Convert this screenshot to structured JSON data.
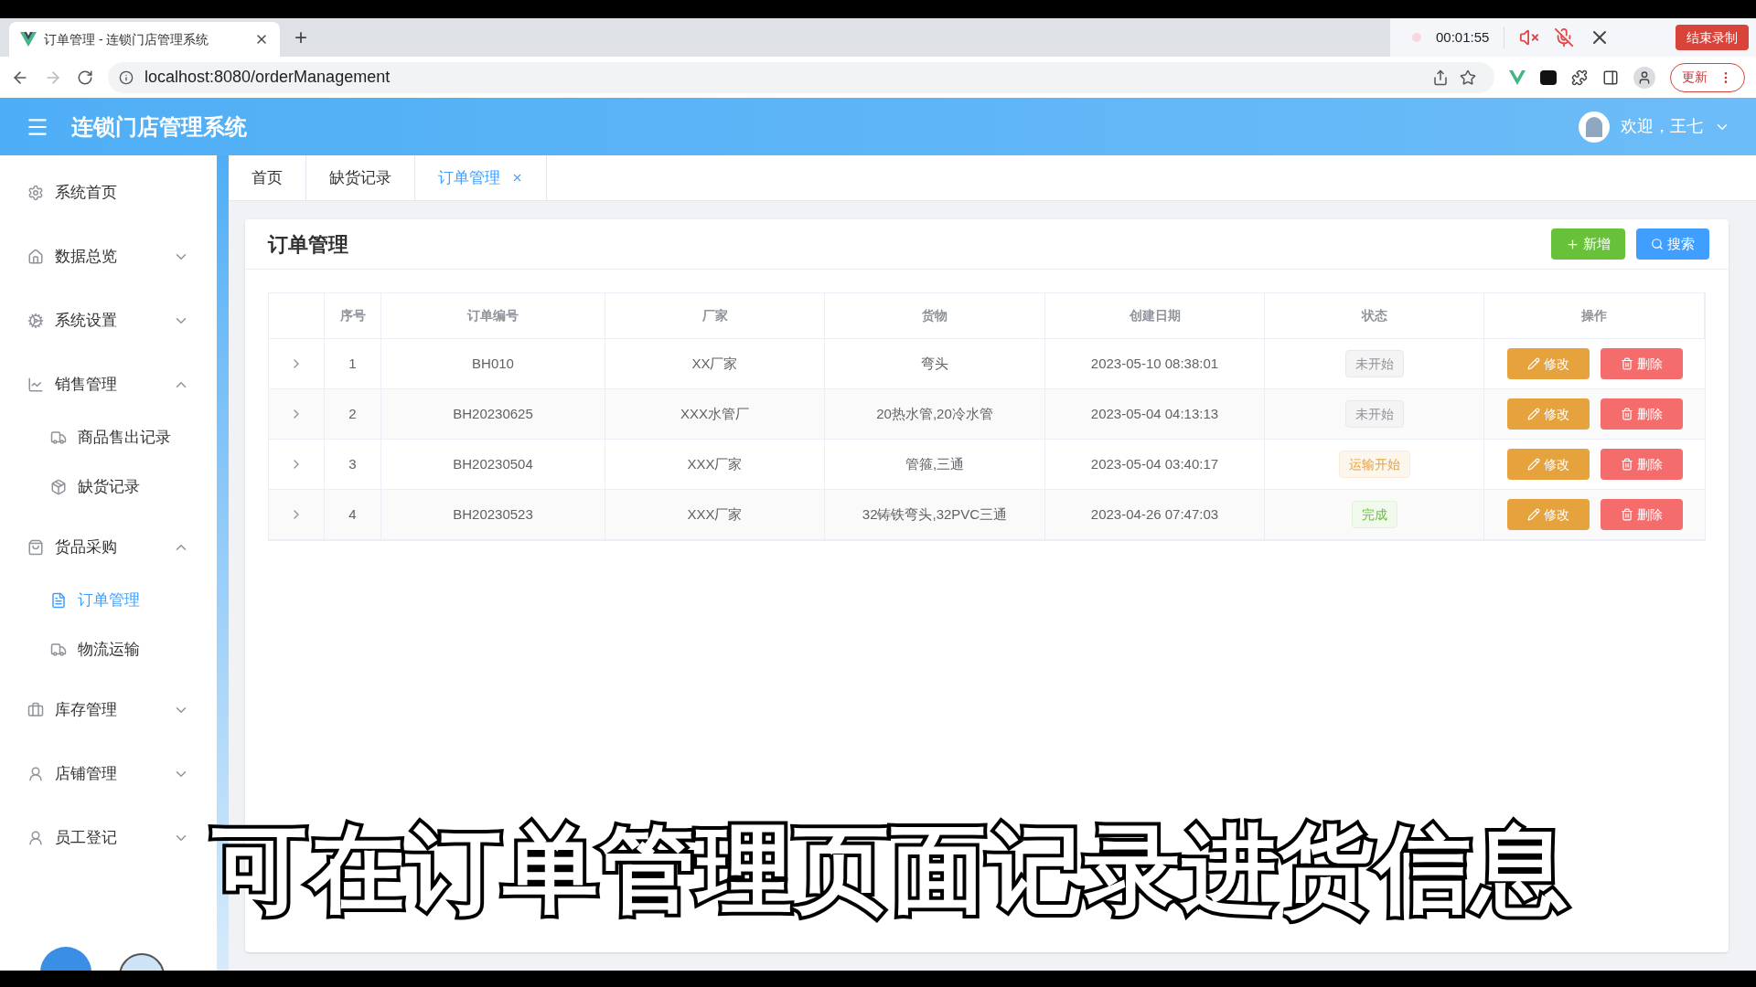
{
  "recorder": {
    "time": "00:01:55",
    "stop_label": "结束录制"
  },
  "browser": {
    "tab_title": "订单管理 - 连锁门店管理系统",
    "new_tab": "+",
    "url": "localhost:8080/orderManagement",
    "update_label": "更新"
  },
  "header": {
    "title": "连锁门店管理系统",
    "greeting": "欢迎，王七"
  },
  "sidebar": {
    "items": [
      {
        "label": "系统首页",
        "kind": "link"
      },
      {
        "label": "数据总览",
        "kind": "group",
        "expanded": false
      },
      {
        "label": "系统设置",
        "kind": "group",
        "expanded": false
      },
      {
        "label": "销售管理",
        "kind": "group",
        "expanded": true,
        "children": [
          {
            "label": "商品售出记录",
            "selected": false
          },
          {
            "label": "缺货记录",
            "selected": false
          }
        ]
      },
      {
        "label": "货品采购",
        "kind": "group",
        "expanded": true,
        "children": [
          {
            "label": "订单管理",
            "selected": true
          },
          {
            "label": "物流运输",
            "selected": false
          }
        ]
      },
      {
        "label": "库存管理",
        "kind": "group",
        "expanded": false
      },
      {
        "label": "店铺管理",
        "kind": "group",
        "expanded": false
      },
      {
        "label": "员工登记",
        "kind": "group",
        "expanded": false
      }
    ]
  },
  "tabs": [
    {
      "label": "首页",
      "selected": false,
      "closable": false
    },
    {
      "label": "缺货记录",
      "selected": false,
      "closable": false
    },
    {
      "label": "订单管理",
      "selected": true,
      "closable": true
    }
  ],
  "card": {
    "title": "订单管理",
    "add_label": "新增",
    "search_label": "搜索"
  },
  "table": {
    "columns": [
      "序号",
      "订单编号",
      "厂家",
      "货物",
      "创建日期",
      "状态",
      "操作"
    ],
    "rows": [
      {
        "index": "1",
        "order_no": "BH010",
        "vendor": "XX厂家",
        "goods": "弯头",
        "created": "2023-05-10 08:38:01",
        "status": "未开始",
        "kind": "pending",
        "edit": "修改",
        "delete": "删除"
      },
      {
        "index": "2",
        "order_no": "BH20230625",
        "vendor": "XXX水管厂",
        "goods": "20热水管,20冷水管",
        "created": "2023-05-04 04:13:13",
        "status": "未开始",
        "kind": "pending",
        "edit": "修改",
        "delete": "删除"
      },
      {
        "index": "3",
        "order_no": "BH20230504",
        "vendor": "XXX厂家",
        "goods": "管箍,三通",
        "created": "2023-05-04 03:40:17",
        "status": "运输开始",
        "kind": "shipping",
        "edit": "修改",
        "delete": "删除"
      },
      {
        "index": "4",
        "order_no": "BH20230523",
        "vendor": "XXX厂家",
        "goods": "32铸铁弯头,32PVC三通",
        "created": "2023-04-26 07:47:03",
        "status": "完成",
        "kind": "done",
        "edit": "修改",
        "delete": "删除"
      }
    ]
  },
  "caption": "可在订单管理页面记录进货信息"
}
